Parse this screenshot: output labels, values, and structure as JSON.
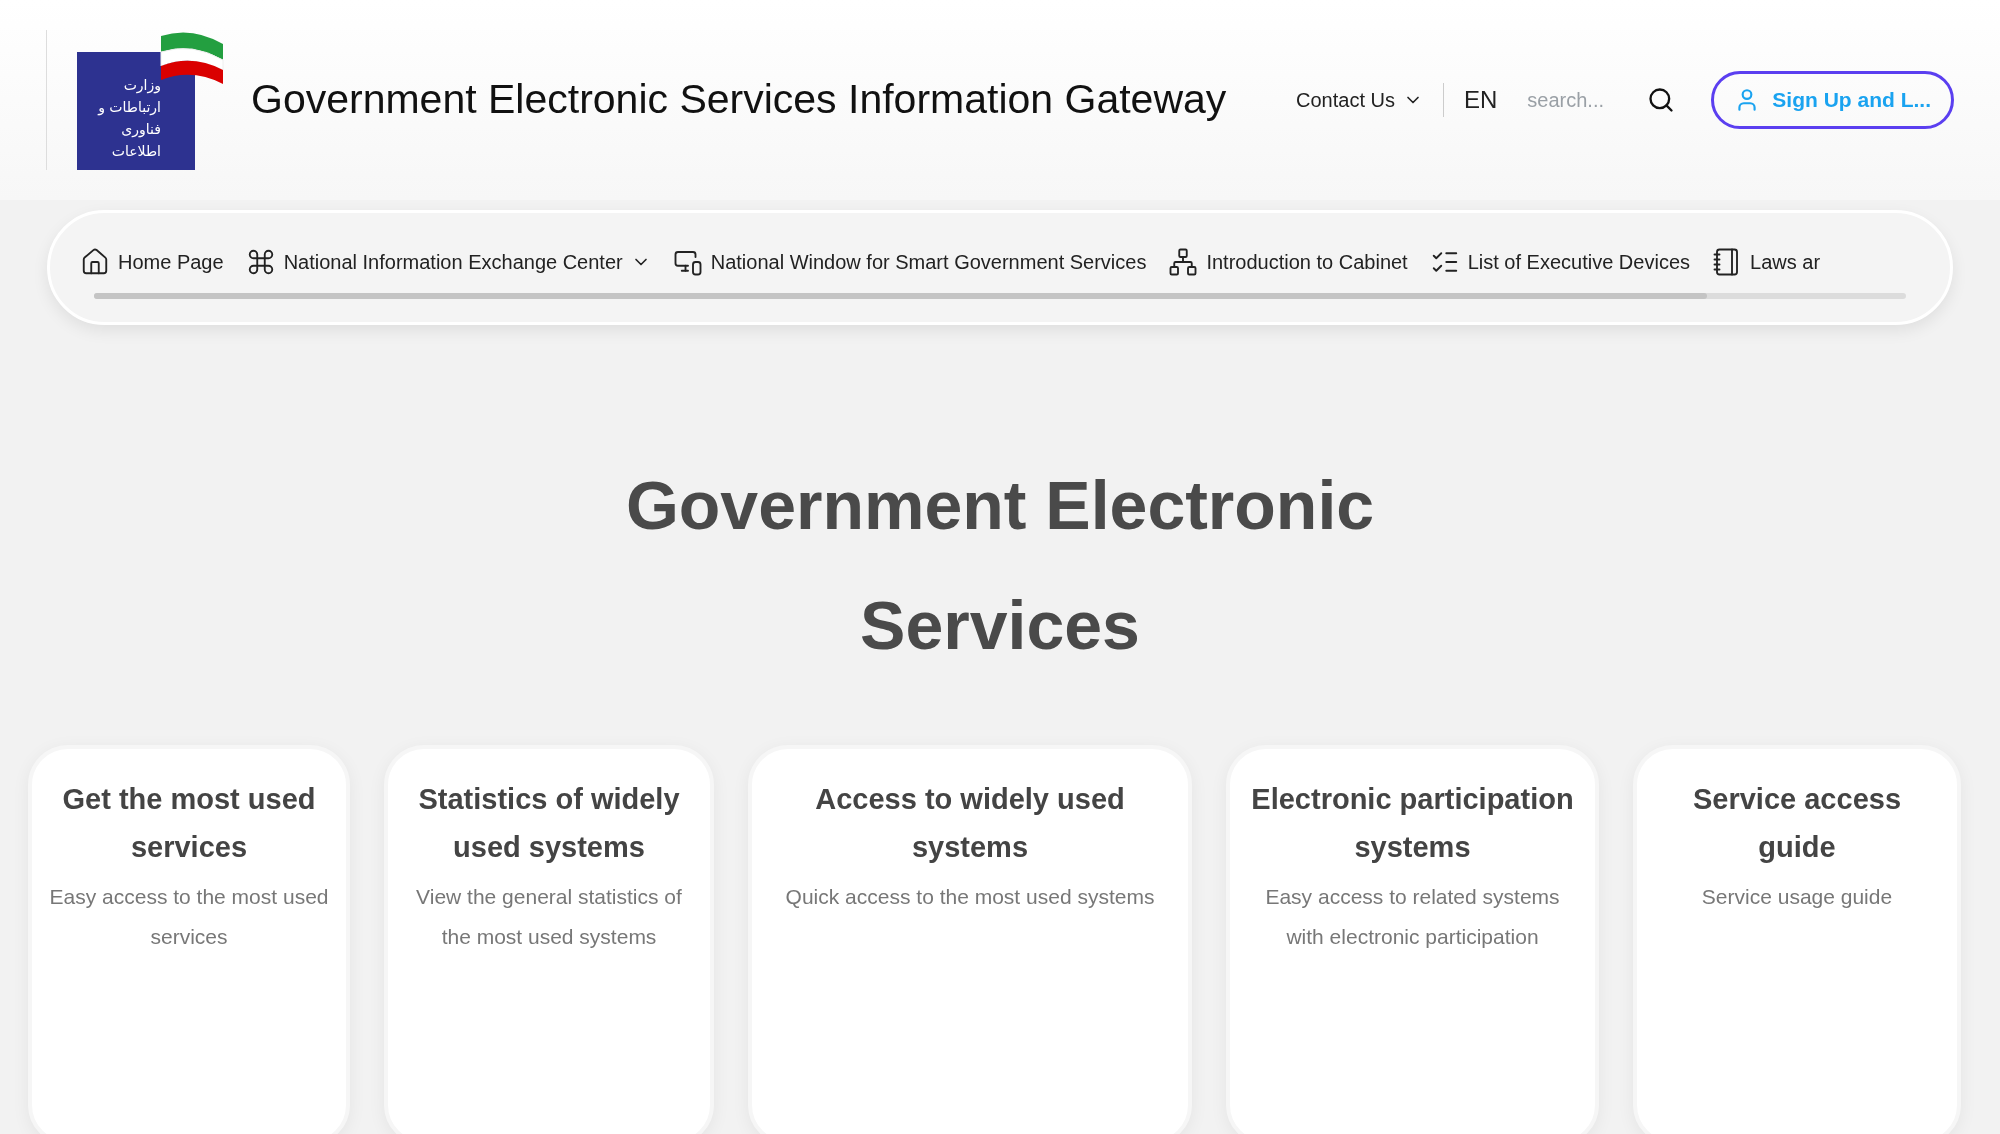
{
  "header": {
    "logo_text": "وزارت ارتباطات و فناوری اطلاعات",
    "title": "Government Electronic Services Information Gateway",
    "contact": "Contact Us",
    "language": "EN",
    "search": {
      "placeholder": "search..."
    },
    "signup": "Sign Up and L..."
  },
  "nav": {
    "items": [
      {
        "label": "Home Page",
        "dropdown": false
      },
      {
        "label": "National Information Exchange Center",
        "dropdown": true
      },
      {
        "label": "National Window for Smart Government Services",
        "dropdown": false
      },
      {
        "label": "Introduction to Cabinet",
        "dropdown": false
      },
      {
        "label": "List of Executive Devices",
        "dropdown": false
      },
      {
        "label": "Laws ar",
        "dropdown": false
      }
    ]
  },
  "hero": {
    "title": "Government Electronic Services"
  },
  "cards": [
    {
      "title": "Get the most used services",
      "description": "Easy access to the most used services"
    },
    {
      "title": "Statistics of widely used systems",
      "description": "View the general statistics of the most used systems"
    },
    {
      "title": "Access to widely used systems",
      "description": "Quick access to the most used systems"
    },
    {
      "title": "Electronic participation systems",
      "description": "Easy access to related systems with electronic participation"
    },
    {
      "title": "Service access guide",
      "description": "Service usage guide"
    }
  ]
}
